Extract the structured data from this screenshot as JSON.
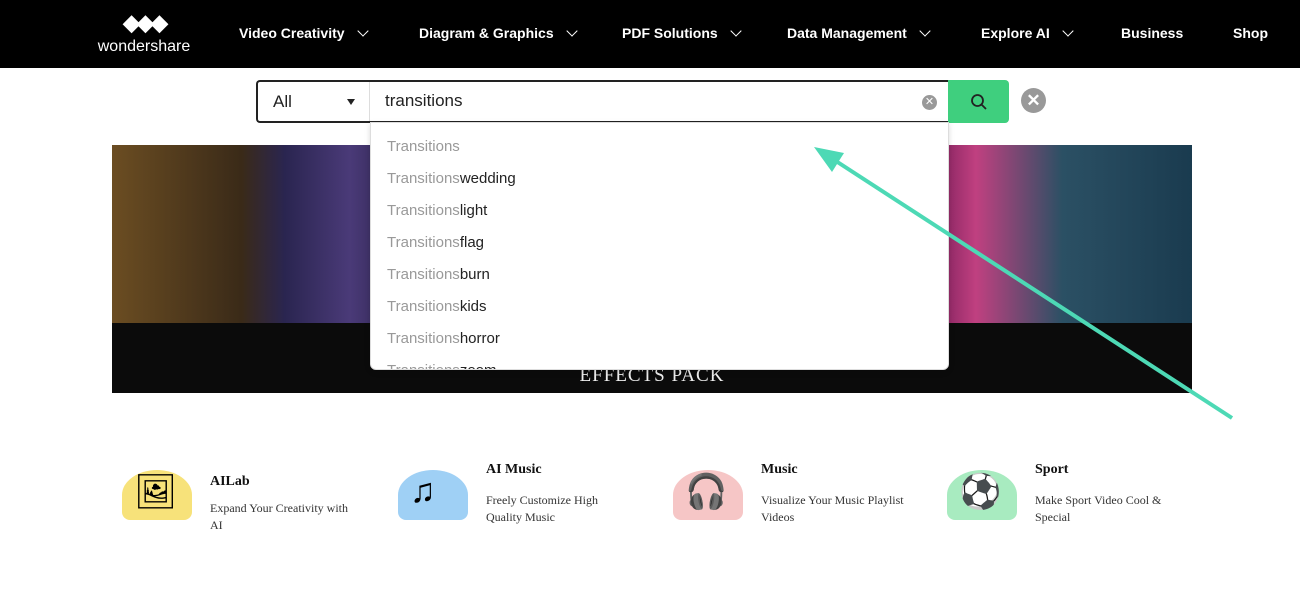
{
  "nav": {
    "logo": "wondershare",
    "items": [
      {
        "label": "Video Creativity",
        "dropdown": true
      },
      {
        "label": "Diagram & Graphics",
        "dropdown": true
      },
      {
        "label": "PDF Solutions",
        "dropdown": true
      },
      {
        "label": "Data Management",
        "dropdown": true
      },
      {
        "label": "Explore AI",
        "dropdown": true
      },
      {
        "label": "Business",
        "dropdown": false
      },
      {
        "label": "Shop",
        "dropdown": false
      }
    ]
  },
  "search": {
    "category": "All",
    "query": "transitions",
    "button_icon": "search-icon",
    "close_icon": "close-icon"
  },
  "suggestions": [
    {
      "prefix": "Transitions",
      "suffix": ""
    },
    {
      "prefix": "Transitions",
      "suffix": "wedding"
    },
    {
      "prefix": "Transitions",
      "suffix": "light"
    },
    {
      "prefix": "Transitions",
      "suffix": "flag"
    },
    {
      "prefix": "Transitions",
      "suffix": "burn"
    },
    {
      "prefix": "Transitions",
      "suffix": "kids"
    },
    {
      "prefix": "Transitions",
      "suffix": "horror"
    },
    {
      "prefix": "Transitions",
      "suffix": "zoom"
    }
  ],
  "banner": {
    "title": "EFFECTS PACK"
  },
  "categories": [
    {
      "title": "AILab",
      "desc": "Expand Your Creativity with AI",
      "color": "#f7e27a",
      "icon": "image-icon"
    },
    {
      "title": "AI Music",
      "desc": "Freely Customize High Quality Music",
      "color": "#9fd0f5",
      "icon": "music-note-icon"
    },
    {
      "title": "Music",
      "desc": "Visualize Your Music Playlist Videos",
      "color": "#f6c6c6",
      "icon": "headphones-icon"
    },
    {
      "title": "Sport",
      "desc": "Make Sport Video Cool & Special",
      "color": "#a8ebc0",
      "icon": "ball-icon"
    }
  ],
  "annotation": {
    "arrow_color": "#4dd9b5"
  }
}
